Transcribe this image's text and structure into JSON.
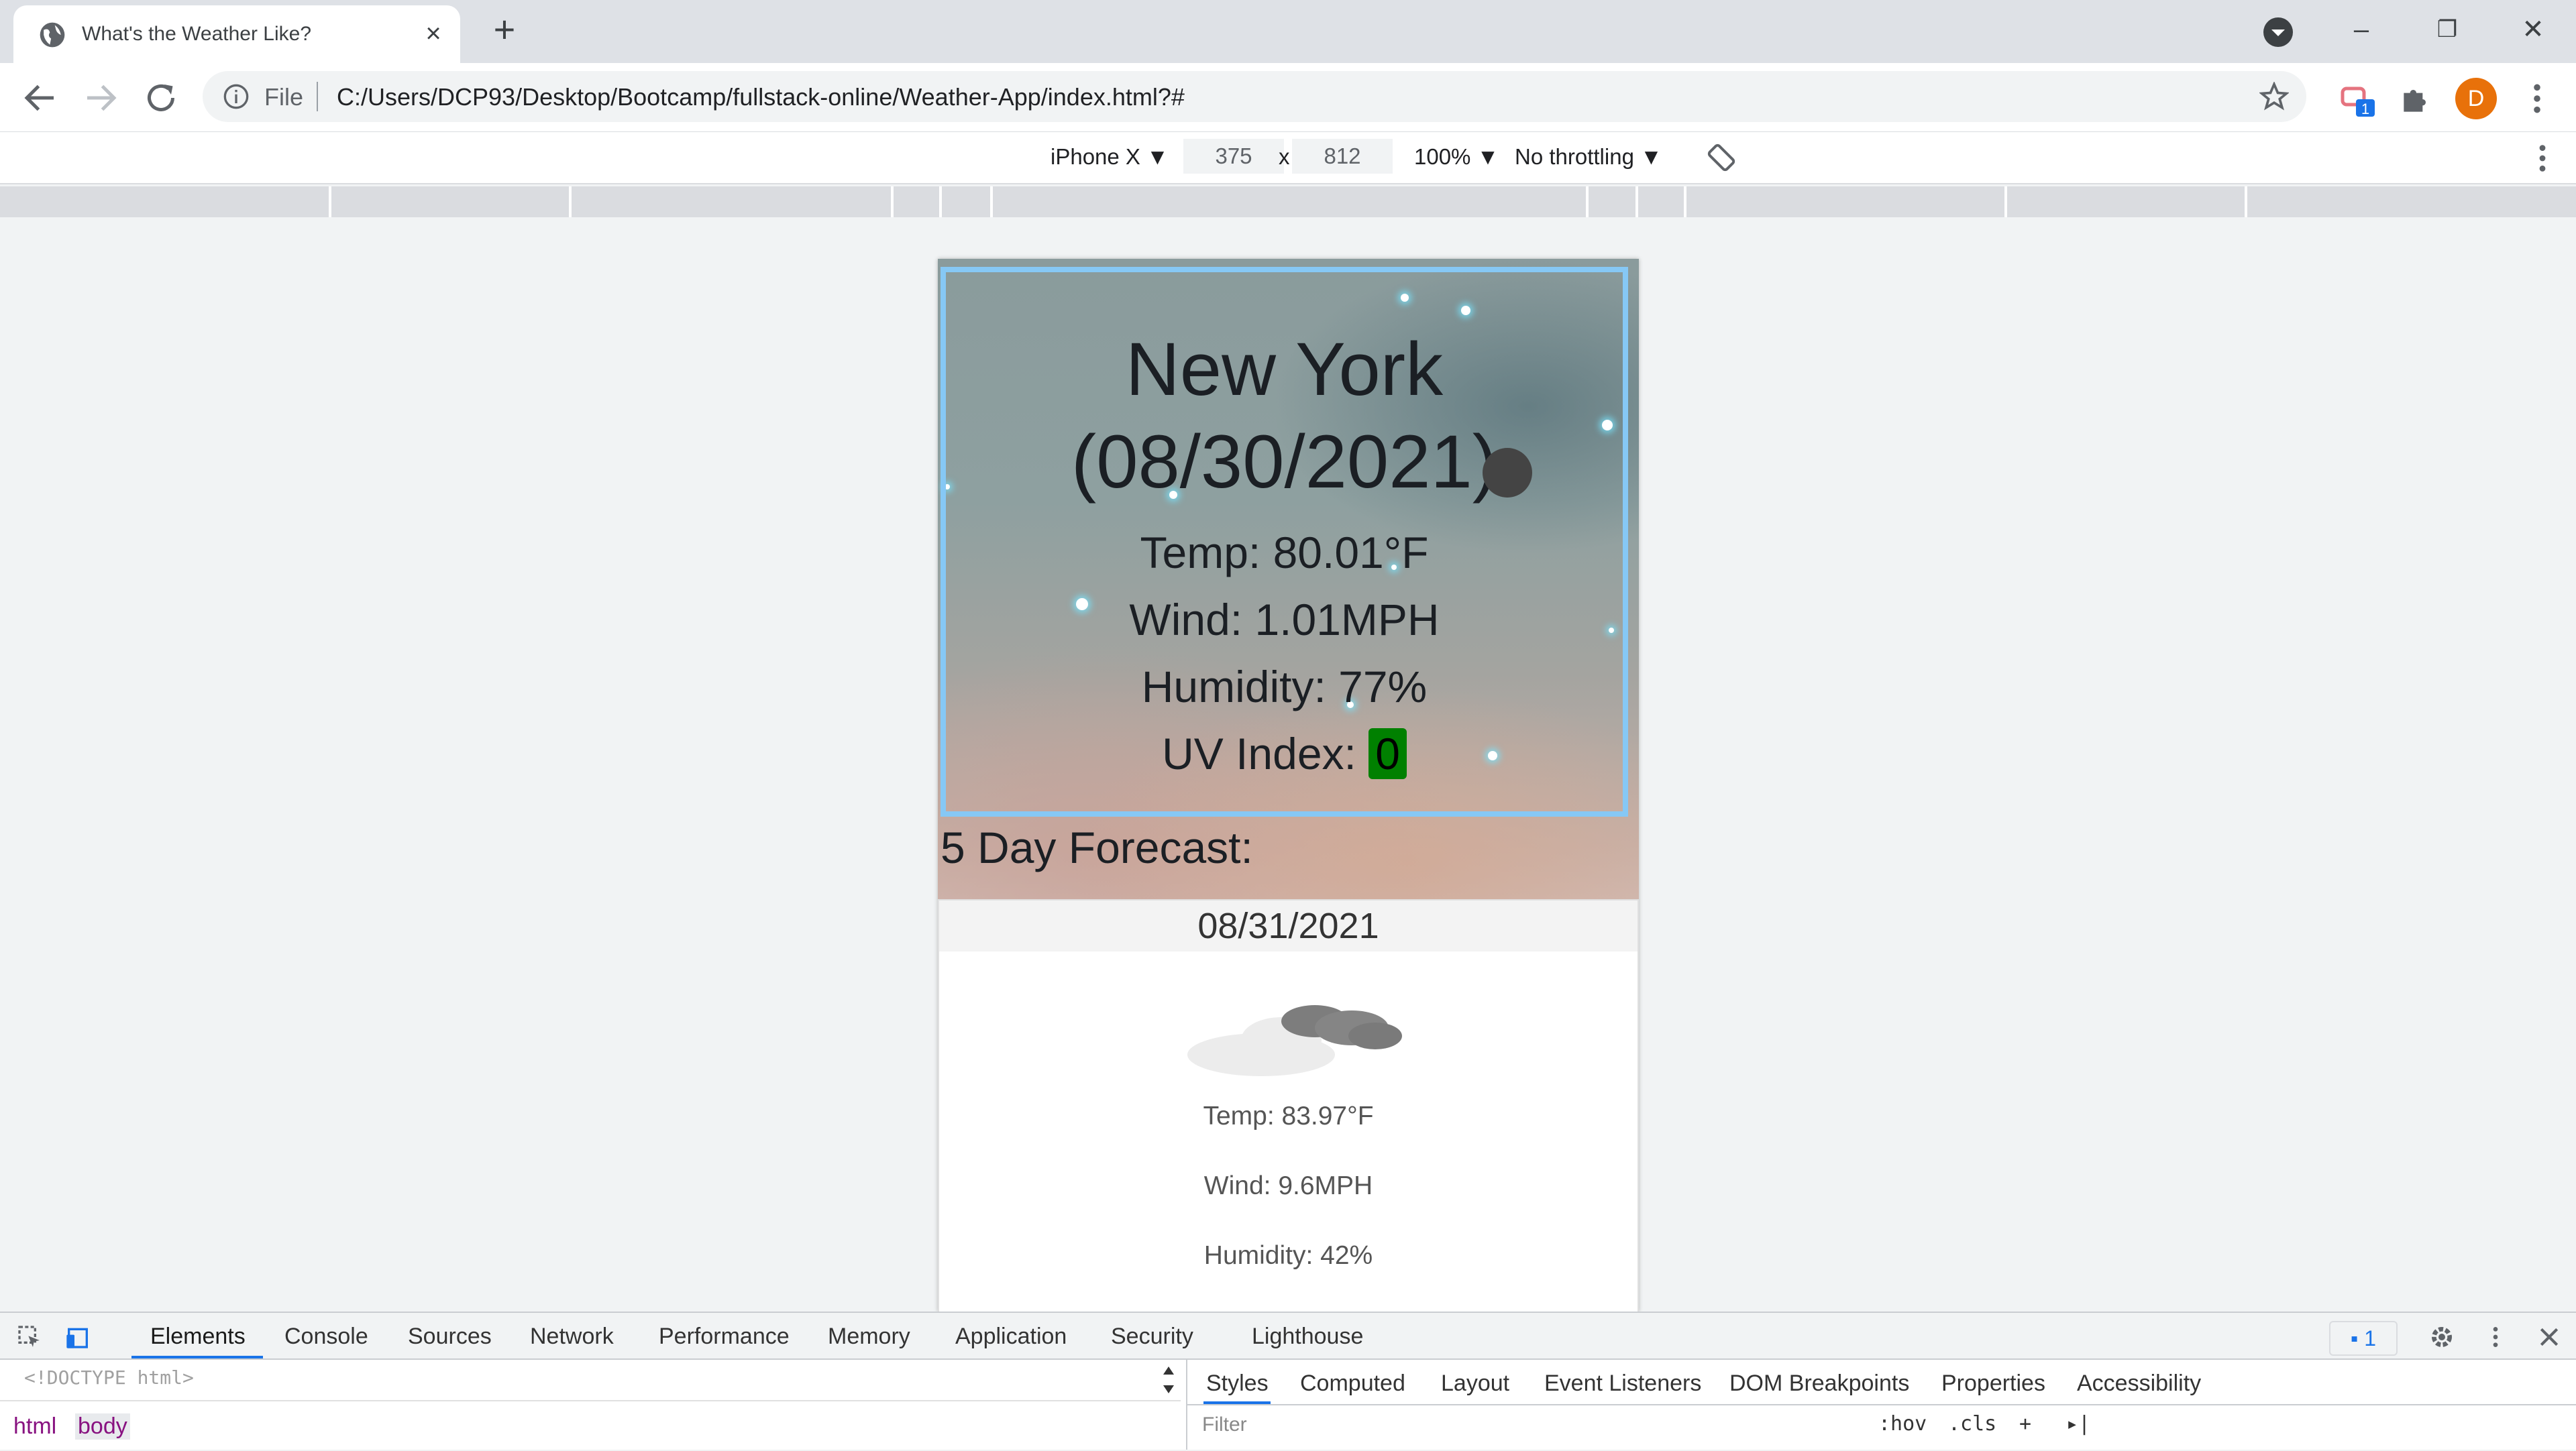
{
  "browser": {
    "tab_title": "What's the Weather Like?",
    "file_label": "File",
    "url": "C:/Users/DCP93/Desktop/Bootcamp/fullstack-online/Weather-App/index.html?#",
    "avatar_letter": "D",
    "extension_badge": "1",
    "accent_color": "#1a73e8"
  },
  "device_toolbar": {
    "device": "iPhone X ▼",
    "width": "375",
    "times": "x",
    "height": "812",
    "zoom": "100% ▼",
    "throttling": "No throttling ▼"
  },
  "weather": {
    "city": "New York",
    "date": "(08/30/2021)",
    "temp": "Temp: 80.01°F",
    "wind": "Wind: 1.01MPH",
    "humidity": "Humidity: 77%",
    "uv_label": "UV Index: ",
    "uv_value": "0",
    "uv_color": "#008000",
    "border_color": "#86c8f5"
  },
  "forecast": {
    "title": "5 Day Forecast:",
    "day1": {
      "date": "08/31/2021",
      "icon": "cloud-icon",
      "temp": "Temp: 83.97°F",
      "wind": "Wind: 9.6MPH",
      "humidity": "Humidity: 42%"
    }
  },
  "devtools": {
    "tabs": [
      "Elements",
      "Console",
      "Sources",
      "Network",
      "Performance",
      "Memory",
      "Application",
      "Security",
      "Lighthouse"
    ],
    "issues_count": "1",
    "doctype": "<!DOCTYPE html>",
    "breadcrumbs": [
      "html",
      "body"
    ],
    "style_tabs": [
      "Styles",
      "Computed",
      "Layout",
      "Event Listeners",
      "DOM Breakpoints",
      "Properties",
      "Accessibility"
    ],
    "filter_placeholder": "Filter",
    "hov": ":hov",
    "cls": ".cls"
  }
}
